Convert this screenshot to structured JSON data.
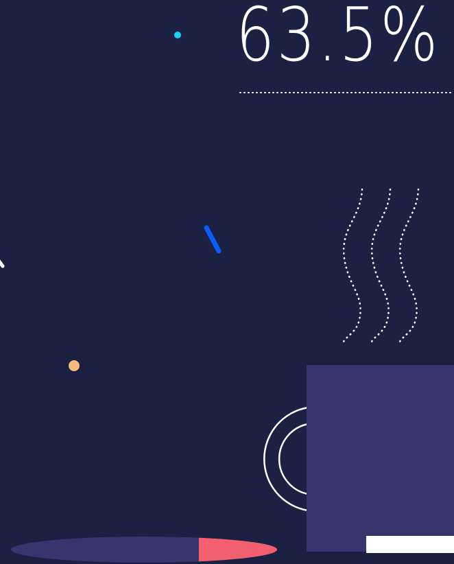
{
  "stat": {
    "value": "63.5%"
  },
  "colors": {
    "background": "#1a2142",
    "mug": "#37356e",
    "accent_cyan": "#1ad0f0",
    "accent_blue": "#0a5cff",
    "accent_peach": "#f7b97c",
    "accent_red": "#f25f6e",
    "line": "#ffffff"
  },
  "icons": {
    "mug": "coffee-mug-icon",
    "steam": "steam-lines-icon"
  }
}
